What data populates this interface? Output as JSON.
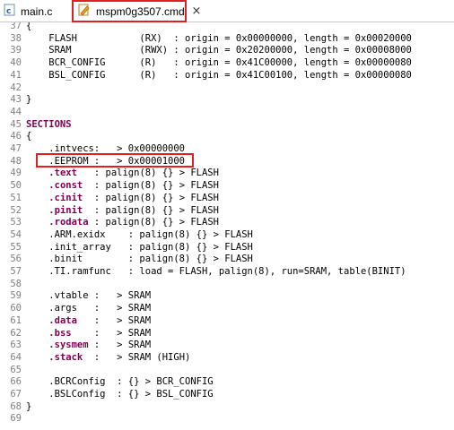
{
  "tabs": [
    {
      "label": "main.c",
      "icon": "c-source-file-icon",
      "active": false
    },
    {
      "label": "mspm0g3507.cmd",
      "icon": "linker-command-file-icon",
      "active": true
    }
  ],
  "close_glyph": "×",
  "colors": {
    "highlight_border": "#e02020",
    "keyword": "#7f0055",
    "line_number": "#808080"
  },
  "lines": [
    {
      "num": "37",
      "text": "{"
    },
    {
      "num": "38",
      "text": "    FLASH           (RX)  : origin = 0x00000000, length = 0x00020000"
    },
    {
      "num": "39",
      "text": "    SRAM            (RWX) : origin = 0x20200000, length = 0x00008000"
    },
    {
      "num": "40",
      "text": "    BCR_CONFIG      (R)   : origin = 0x41C00000, length = 0x00000080"
    },
    {
      "num": "41",
      "text": "    BSL_CONFIG      (R)   : origin = 0x41C00100, length = 0x00000080"
    },
    {
      "num": "42",
      "text": ""
    },
    {
      "num": "43",
      "text": "}"
    },
    {
      "num": "44",
      "text": ""
    },
    {
      "num": "45",
      "pre": "",
      "kw": "SECTIONS",
      "post": ""
    },
    {
      "num": "46",
      "text": "{"
    },
    {
      "num": "47",
      "text": "    .intvecs:   > 0x00000000"
    },
    {
      "num": "48",
      "text": "    .EEPROM :   > 0x00001000",
      "highlight": true
    },
    {
      "num": "49",
      "pre": "    ",
      "kw": ".text",
      "post": "   : palign(8) {} > FLASH"
    },
    {
      "num": "50",
      "pre": "    ",
      "kw": ".const",
      "post": "  : palign(8) {} > FLASH"
    },
    {
      "num": "51",
      "pre": "    ",
      "kw": ".cinit",
      "post": "  : palign(8) {} > FLASH"
    },
    {
      "num": "52",
      "pre": "    ",
      "kw": ".pinit",
      "post": "  : palign(8) {} > FLASH"
    },
    {
      "num": "53",
      "pre": "    ",
      "kw": ".rodata",
      "post": " : palign(8) {} > FLASH"
    },
    {
      "num": "54",
      "text": "    .ARM.exidx    : palign(8) {} > FLASH"
    },
    {
      "num": "55",
      "text": "    .init_array   : palign(8) {} > FLASH"
    },
    {
      "num": "56",
      "text": "    .binit        : palign(8) {} > FLASH"
    },
    {
      "num": "57",
      "text": "    .TI.ramfunc   : load = FLASH, palign(8), run=SRAM, table(BINIT)"
    },
    {
      "num": "58",
      "text": ""
    },
    {
      "num": "59",
      "text": "    .vtable :   > SRAM"
    },
    {
      "num": "60",
      "text": "    .args   :   > SRAM"
    },
    {
      "num": "61",
      "pre": "    ",
      "kw": ".data",
      "post": "   :   > SRAM"
    },
    {
      "num": "62",
      "pre": "    ",
      "kw": ".bss",
      "post": "    :   > SRAM"
    },
    {
      "num": "63",
      "pre": "    ",
      "kw": ".sysmem",
      "post": " :   > SRAM"
    },
    {
      "num": "64",
      "pre": "    ",
      "kw": ".stack",
      "post": "  :   > SRAM (HIGH)"
    },
    {
      "num": "65",
      "text": ""
    },
    {
      "num": "66",
      "text": "    .BCRConfig  : {} > BCR_CONFIG"
    },
    {
      "num": "67",
      "text": "    .BSLConfig  : {} > BSL_CONFIG"
    },
    {
      "num": "68",
      "text": "}"
    },
    {
      "num": "69",
      "text": ""
    }
  ]
}
